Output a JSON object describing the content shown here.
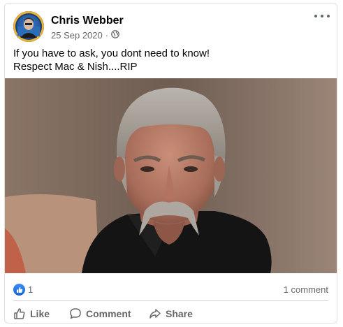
{
  "post": {
    "author": "Chris Webber",
    "date": "25 Sep 2020",
    "separator": "·",
    "privacy_icon": "globe-icon",
    "text_lines": [
      "If you have to ask, you dont need to know!",
      "Respect Mac & Nish....RIP"
    ]
  },
  "reactions": {
    "like_icon": "thumbs-up-icon",
    "count": "1",
    "comments": "1 comment"
  },
  "actions": {
    "like": "Like",
    "comment": "Comment",
    "share": "Share"
  },
  "colors": {
    "reaction_blue": "#1877f2",
    "secondary_text": "#65676b"
  }
}
